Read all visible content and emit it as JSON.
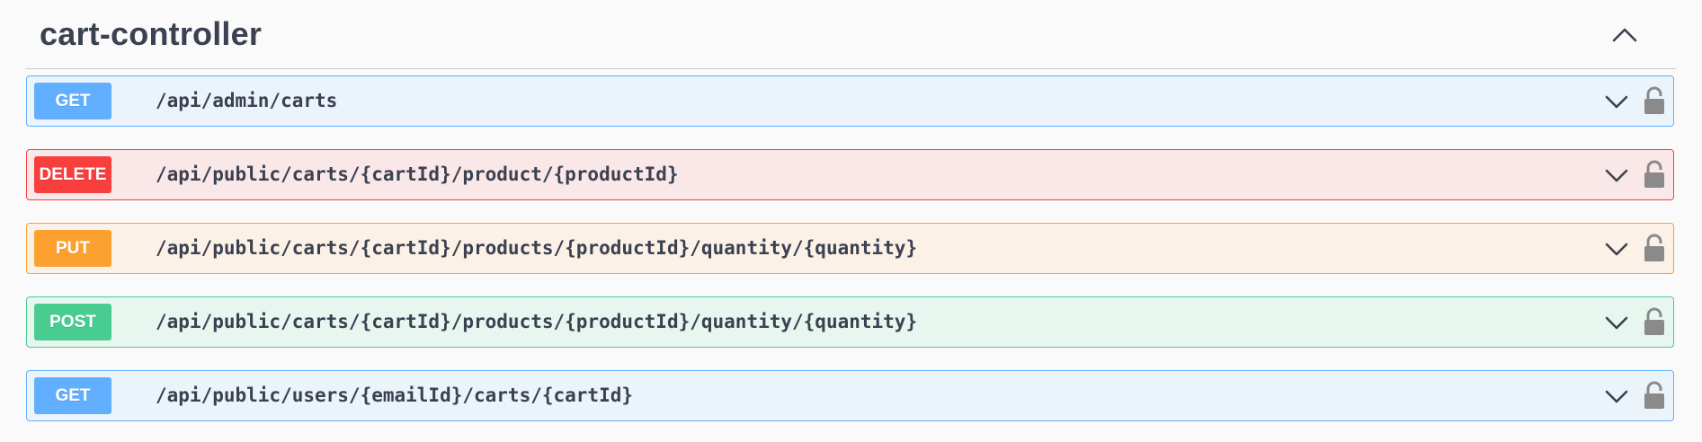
{
  "section": {
    "title": "cart-controller",
    "collapse_icon": "chevron-up-icon"
  },
  "operations": [
    {
      "method": "GET",
      "path": "/api/admin/carts",
      "color": "#61affe",
      "bg": "#ebf3fb",
      "border": "#61affe"
    },
    {
      "method": "DELETE",
      "path": "/api/public/carts/{cartId}/product/{productId}",
      "color": "#f93e3e",
      "bg": "#fae7e7",
      "border": "#f93e3e"
    },
    {
      "method": "PUT",
      "path": "/api/public/carts/{cartId}/products/{productId}/quantity/{quantity}",
      "color": "#fca130",
      "bg": "#fbf1e6",
      "border": "#fca130"
    },
    {
      "method": "POST",
      "path": "/api/public/carts/{cartId}/products/{productId}/quantity/{quantity}",
      "color": "#49cc90",
      "bg": "#e8f6f0",
      "border": "#49cc90"
    },
    {
      "method": "GET",
      "path": "/api/public/users/{emailId}/carts/{cartId}",
      "color": "#61affe",
      "bg": "#ebf3fb",
      "border": "#61affe"
    }
  ],
  "icons": {
    "expand": "chevron-down-icon",
    "auth": "lock-icon"
  }
}
